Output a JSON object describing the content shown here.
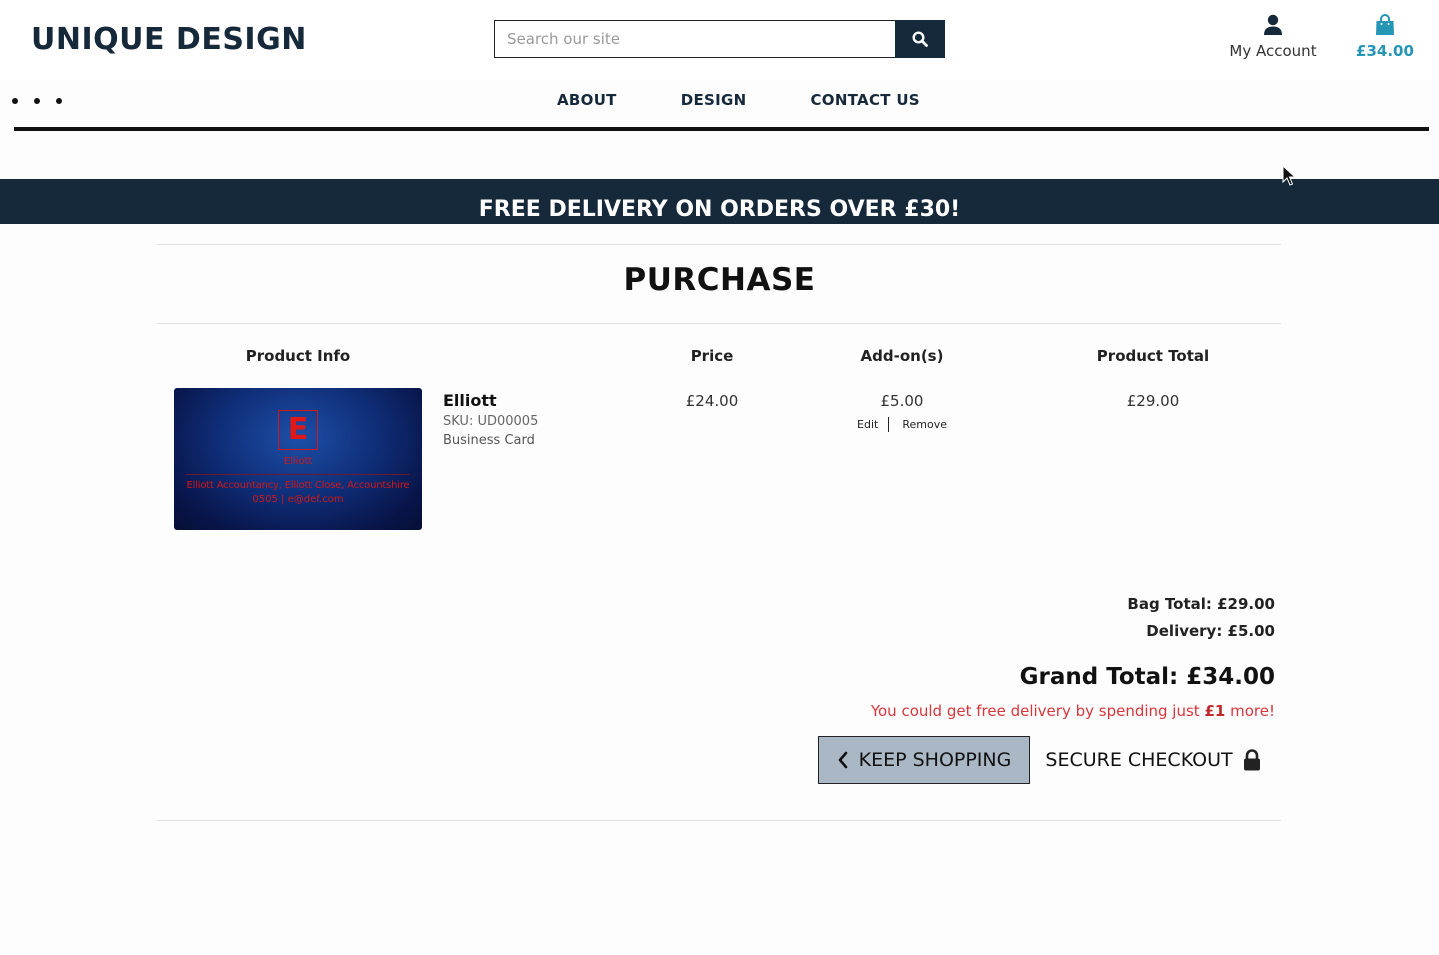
{
  "header": {
    "logo": "UNIQUE DESIGN",
    "search_placeholder": "Search our site",
    "search_icon": "search-icon",
    "account_label": "My Account",
    "account_icon": "user-icon",
    "bag_total": "£34.00",
    "bag_icon": "shopping-bag-icon",
    "bag_color": "#2596b4"
  },
  "nav": {
    "toggle_icon": "dots-menu-icon",
    "links": [
      "ABOUT",
      "DESIGN",
      "CONTACT US"
    ]
  },
  "banner": {
    "text": "FREE DELIVERY ON ORDERS OVER £30!",
    "background": "#15293a"
  },
  "page": {
    "title": "PURCHASE"
  },
  "table": {
    "headers": {
      "product_info": "Product Info",
      "price": "Price",
      "addons": "Add-on(s)",
      "product_total": "Product Total"
    },
    "items": [
      {
        "name": "Elliott",
        "sku": "SKU: UD00005",
        "type": "Business Card",
        "price": "£24.00",
        "addons": "£5.00",
        "edit_label": "Edit",
        "remove_label": "Remove",
        "total": "£29.00",
        "thumbnail": {
          "monogram": "E",
          "name": "Elliott",
          "address": "Elliott Accountancy, Elliott Close, Accountshire",
          "contact": "0505 | e@def.com"
        }
      }
    ]
  },
  "summary": {
    "bag_total": "Bag Total: £29.00",
    "delivery": "Delivery: £5.00",
    "grand_total": "Grand Total: £34.00",
    "free_delivery_prefix": "You could get free delivery by spending just",
    "free_delivery_amount": "£1",
    "free_delivery_suffix": "more!",
    "note_color": "#d9353a"
  },
  "actions": {
    "keep_shopping": "KEEP SHOPPING",
    "keep_shopping_icon": "chevron-left-icon",
    "secure_checkout": "SECURE CHECKOUT",
    "secure_checkout_icon": "lock-icon"
  }
}
